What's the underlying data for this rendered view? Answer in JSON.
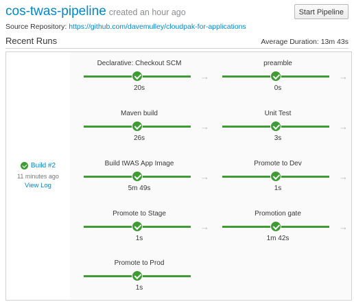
{
  "header": {
    "title": "cos-twas-pipeline",
    "created": "created an hour ago",
    "start_button": "Start Pipeline"
  },
  "repo": {
    "label": "Source Repository:",
    "url": "https://github.com/davemulley/cloudpak-for-applications"
  },
  "runs": {
    "title": "Recent Runs",
    "average_duration": "Average Duration: 13m 43s"
  },
  "build": {
    "name": "Build #2",
    "time": "11 minutes ago",
    "view_log": "View Log",
    "status": "success"
  },
  "stages": [
    {
      "name": "Declarative: Checkout SCM",
      "duration": "20s"
    },
    {
      "name": "preamble",
      "duration": "0s"
    },
    {
      "name": "Maven build",
      "duration": "26s"
    },
    {
      "name": "Unit Test",
      "duration": "3s"
    },
    {
      "name": "Build tWAS App Image",
      "duration": "5m 49s"
    },
    {
      "name": "Promote to Dev",
      "duration": "1s"
    },
    {
      "name": "Promote to Stage",
      "duration": "1s"
    },
    {
      "name": "Promotion gate",
      "duration": "1m 42s"
    },
    {
      "name": "Promote to Prod",
      "duration": "1s"
    }
  ],
  "colors": {
    "accent": "#0088ce",
    "success": "#3f9c35"
  }
}
